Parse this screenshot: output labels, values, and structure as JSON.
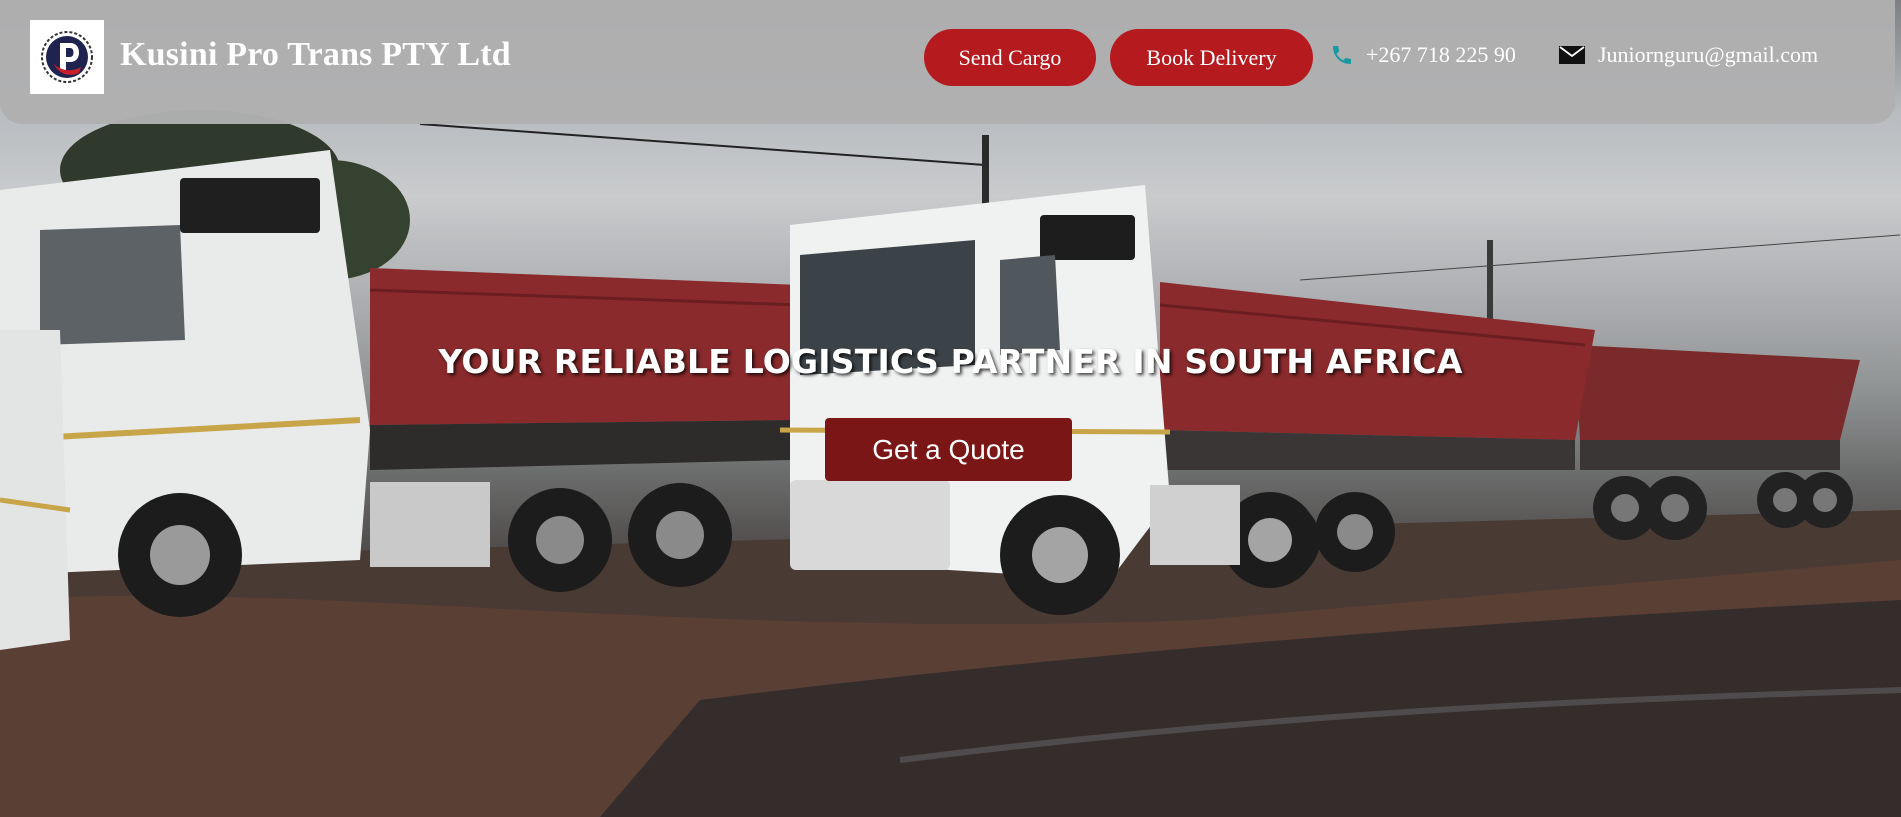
{
  "header": {
    "brand_name": "Kusini Pro Trans PTY Ltd",
    "logo_icon": "p-letter-logo-icon",
    "send_cargo_label": "Send Cargo",
    "book_delivery_label": "Book Delivery",
    "phone": "+267 718 225 90",
    "phone_icon": "phone-icon",
    "email": "Juniornguru@gmail.com",
    "email_icon": "envelope-icon"
  },
  "hero": {
    "title": "YOUR RELIABLE LOGISTICS PARTNER IN SOUTH AFRICA",
    "cta_label": "Get a Quote",
    "background": "photo of white trucks hauling red side-tipper trailers on a wet lot"
  },
  "colors": {
    "header_bg": "#afafb1",
    "button_red": "#b51a1f",
    "quote_button": "#7a1616",
    "phone_icon": "#1a9aa0",
    "text_white": "#ffffff"
  }
}
